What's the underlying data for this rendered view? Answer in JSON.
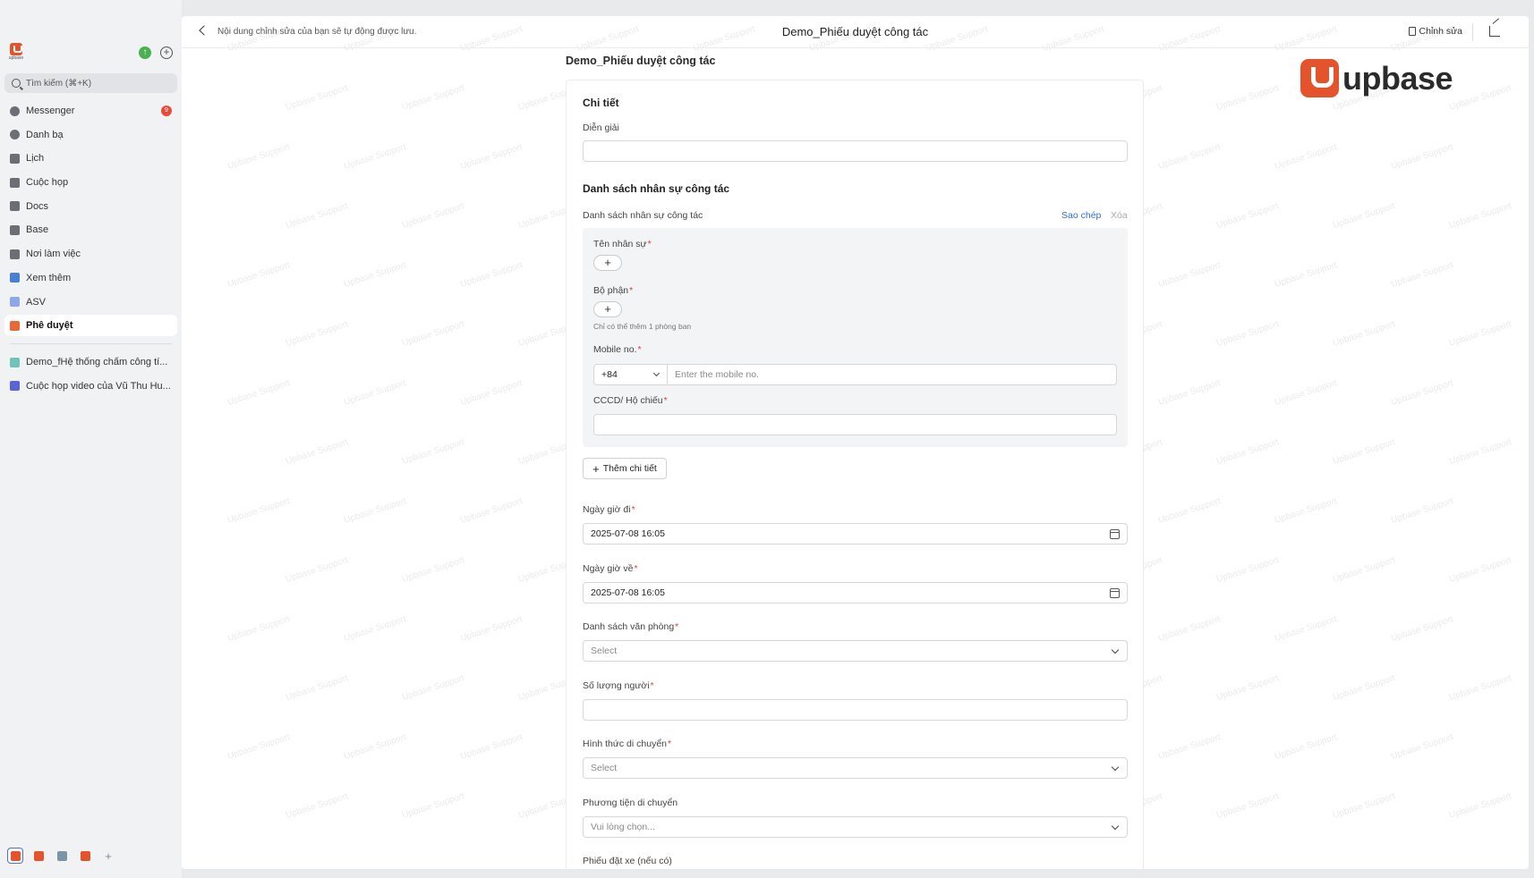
{
  "sidebar": {
    "logo_text": "upbase",
    "search_placeholder": "Tìm kiếm (⌘+K)",
    "items": [
      {
        "label": "Messenger",
        "badge": "9"
      },
      {
        "label": "Danh bạ"
      },
      {
        "label": "Lịch"
      },
      {
        "label": "Cuộc họp"
      },
      {
        "label": "Docs"
      },
      {
        "label": "Base"
      },
      {
        "label": "Nơi làm việc"
      },
      {
        "label": "Xem thêm"
      },
      {
        "label": "ASV"
      },
      {
        "label": "Phê duyệt"
      }
    ],
    "recent": [
      {
        "label": "Demo_fHệ thống chấm công tí..."
      },
      {
        "label": "Cuộc họp video của Vũ Thu Hu..."
      }
    ]
  },
  "topbar": {
    "autosave_notice": "Nội dung chỉnh sửa của bạn sẽ tự động được lưu.",
    "title": "Demo_Phiếu duyệt công tác",
    "edit_label": "Chỉnh sửa"
  },
  "form": {
    "header": "Demo_Phiếu duyệt công tác",
    "brand": "upbase",
    "section_detail": "Chi tiết",
    "dien_giai_label": "Diễn giải",
    "section_staff": "Danh sách nhân sự công tác",
    "staff_list_label": "Danh sách nhân sự công tác",
    "copy_label": "Sao chép",
    "delete_label": "Xóa",
    "staff_name_label": "Tên nhân sự",
    "department_label": "Bộ phận",
    "department_hint": "Chỉ có thể thêm 1 phòng ban",
    "mobile_label": "Mobile no.",
    "mobile_code": "+84",
    "mobile_placeholder": "Enter the mobile no.",
    "id_label": "CCCD/ Hộ chiếu",
    "add_detail_label": "Thêm chi tiết",
    "depart_label": "Ngày giờ đi",
    "depart_value": "2025-07-08 16:05",
    "return_label": "Ngày giờ về",
    "return_value": "2025-07-08 16:05",
    "offices_label": "Danh sách văn phòng",
    "offices_placeholder": "Select",
    "people_count_label": "Số lượng người",
    "transport_type_label": "Hình thức di chuyển",
    "transport_type_placeholder": "Select",
    "vehicle_label": "Phương tiện di chuyển",
    "vehicle_placeholder": "Vui lòng chọn...",
    "car_booking_label": "Phiếu đặt xe (nếu có)",
    "required_mark": "*"
  },
  "watermark": "Upbase Support",
  "colors": {
    "accent": "#e5532d",
    "link": "#2f6fe0",
    "required": "#e23c3c",
    "online": "#4caf50"
  }
}
